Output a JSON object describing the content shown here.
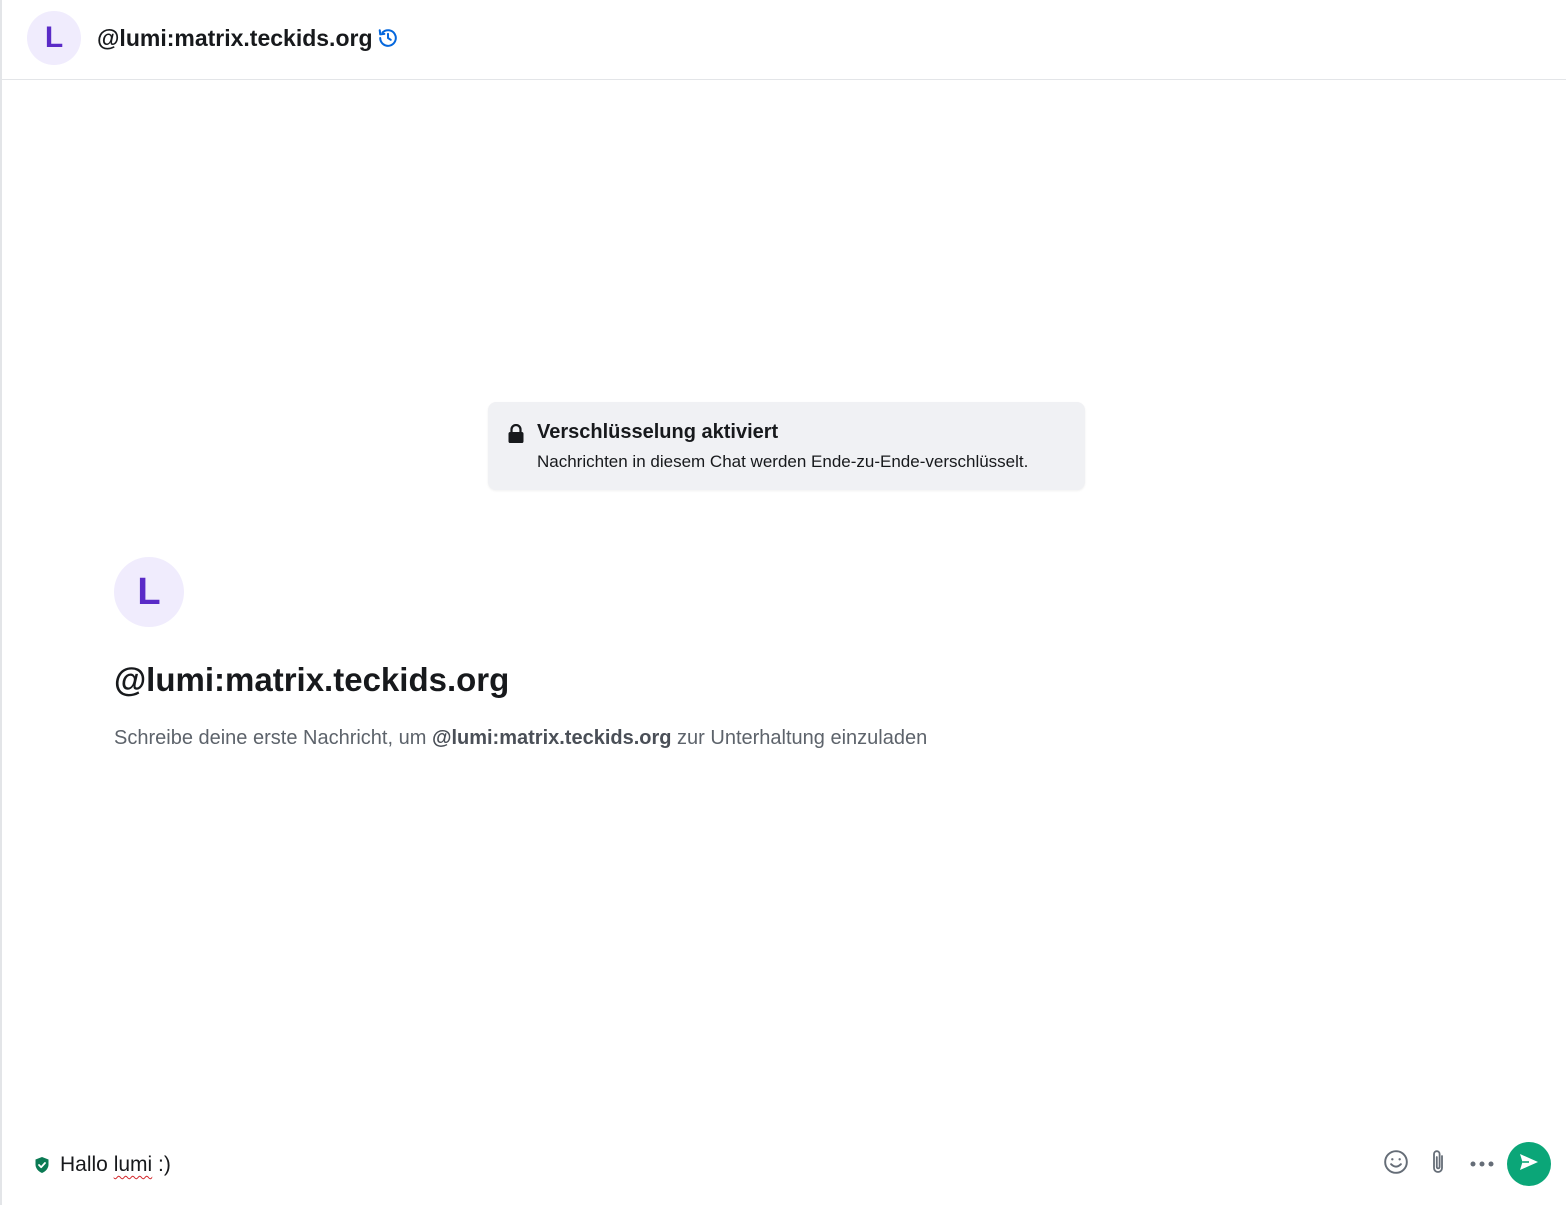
{
  "header": {
    "avatar_initial": "L",
    "title": "@lumi:matrix.teckids.org",
    "history_icon": "history-icon"
  },
  "encryption_notice": {
    "icon": "lock-icon",
    "title": "Verschlüsselung aktiviert",
    "description": "Nachrichten in diesem Chat werden Ende-zu-Ende-verschlüsselt."
  },
  "intro": {
    "avatar_initial": "L",
    "title": "@lumi:matrix.teckids.org",
    "text_before": "Schreibe deine erste Nachricht, um ",
    "user": "@lumi:matrix.teckids.org",
    "text_after": " zur Unterhaltung einzuladen"
  },
  "composer": {
    "value_prefix": "Hallo ",
    "value_misspelled": "lumi",
    "value_suffix": " :)",
    "shield_icon": "shield-check-icon",
    "emoji_icon": "emoji-icon",
    "attach_icon": "paperclip-icon",
    "more_icon": "more-horizontal-icon",
    "send_icon": "send-icon"
  },
  "colors": {
    "accent_purple": "#5a2bc7",
    "avatar_bg": "#f0ecfd",
    "send_green": "#0ba678",
    "history_blue": "#0467dd",
    "shield_green": "#0b7a54"
  }
}
